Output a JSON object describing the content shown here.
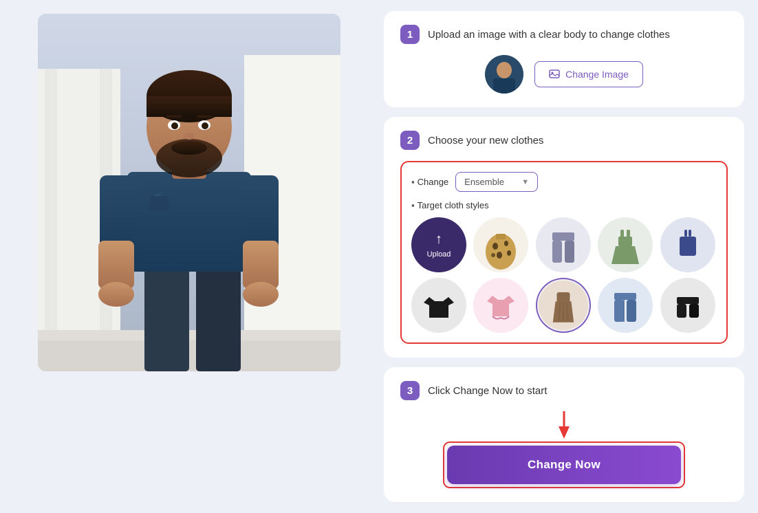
{
  "left": {
    "alt": "Person in navy t-shirt"
  },
  "steps": {
    "step1": {
      "number": "1",
      "title": "Upload an image with a clear body to change clothes",
      "change_image_label": "Change Image"
    },
    "step2": {
      "number": "2",
      "title": "Choose your new clothes",
      "change_label": "Change",
      "dropdown_value": "Ensemble",
      "target_cloth_label": "Target cloth styles",
      "clothes": [
        {
          "id": "upload",
          "label": "Upload",
          "type": "upload"
        },
        {
          "id": "leopard-skirt",
          "label": "Leopard skirt",
          "type": "leopard"
        },
        {
          "id": "gray-pants",
          "label": "Gray pants",
          "type": "gray"
        },
        {
          "id": "green-dress",
          "label": "Green dress",
          "type": "green"
        },
        {
          "id": "blue-top",
          "label": "Blue top",
          "type": "blue"
        },
        {
          "id": "black-tshirt",
          "label": "Black t-shirt",
          "type": "black"
        },
        {
          "id": "pink-top",
          "label": "Pink top",
          "type": "pink"
        },
        {
          "id": "brown-dress",
          "label": "Brown dress",
          "type": "brown",
          "selected": true
        },
        {
          "id": "blue-jeans",
          "label": "Blue jeans",
          "type": "jeans"
        },
        {
          "id": "black-shorts",
          "label": "Black shorts",
          "type": "shorts"
        }
      ]
    },
    "step3": {
      "number": "3",
      "title": "Click Change Now to start",
      "button_label": "Change Now"
    }
  }
}
